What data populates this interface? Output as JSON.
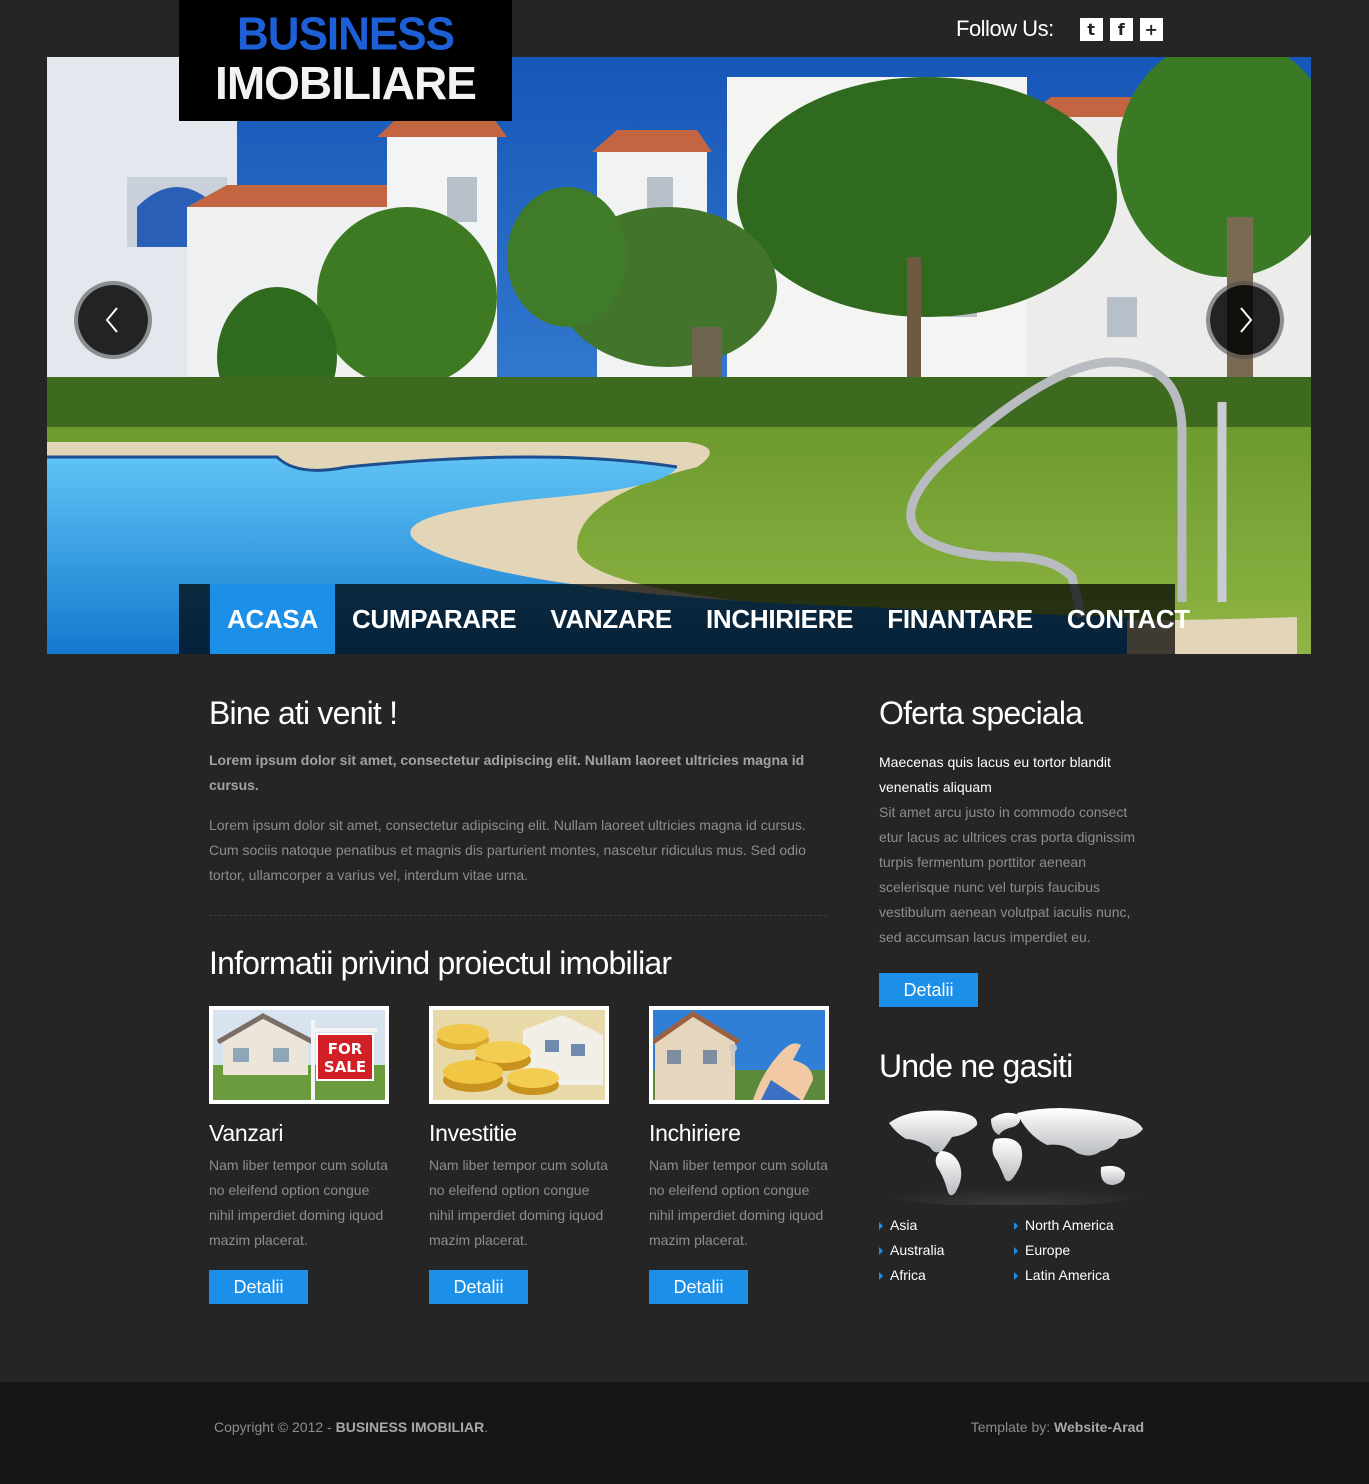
{
  "header": {
    "logo_line1": "BUSINESS",
    "logo_line2": "IMOBILIARE",
    "follow_label": "Follow Us:",
    "social": [
      "twitter-icon",
      "facebook-icon",
      "plus-icon"
    ],
    "twitter_glyph": "t",
    "facebook_glyph": "f",
    "plus_glyph": "+"
  },
  "slider": {
    "prev_icon": "chevron-left-icon",
    "next_icon": "chevron-right-icon"
  },
  "nav": {
    "items": [
      "ACASA",
      "CUMPARARE",
      "VANZARE",
      "INCHIRIERE",
      "FINANTARE",
      "CONTACT"
    ],
    "active": "ACASA"
  },
  "welcome": {
    "title": "Bine ati venit !",
    "lead": "Lorem ipsum dolor sit amet, consectetur adipiscing elit. Nullam laoreet ultricies magna id cursus.",
    "body": "Lorem ipsum dolor sit amet, consectetur adipiscing elit. Nullam laoreet ultricies magna id cursus. Cum sociis natoque penatibus et magnis dis parturient montes, nascetur ridiculus mus. Sed odio tortor, ullamcorper a varius vel, interdum vitae urna."
  },
  "info": {
    "title": "Informatii privind proiectul imobiliar",
    "cards": [
      {
        "title": "Vanzari",
        "text": "Nam liber tempor cum soluta no eleifend option congue nihil imperdiet doming iquod mazim placerat.",
        "button": "Detalii",
        "sign_line1": "FOR",
        "sign_line2": "SALE"
      },
      {
        "title": "Investitie",
        "text": "Nam liber tempor cum soluta no eleifend option congue nihil imperdiet doming iquod mazim placerat.",
        "button": "Detalii"
      },
      {
        "title": "Inchiriere",
        "text": "Nam liber tempor cum soluta no eleifend option congue nihil imperdiet doming iquod mazim placerat.",
        "button": "Detalii"
      }
    ]
  },
  "offer": {
    "title": "Oferta speciala",
    "highlight": "Maecenas quis lacus eu tortor blandit venenatis aliquam",
    "body": "Sit amet arcu justo in commodo consect etur lacus ac ultrices cras porta dignissim turpis fermentum porttitor aenean scelerisque nunc vel turpis faucibus vestibulum aenean volutpat iaculis nunc, sed accumsan lacus imperdiet eu.",
    "button": "Detalii"
  },
  "locations": {
    "title": "Unde ne gasiti",
    "regions": [
      "Asia",
      "North America",
      "Australia",
      "Europe",
      "Africa",
      "Latin America"
    ]
  },
  "footer": {
    "copyright_prefix": "Copyright © 2012 - ",
    "copyright_name": "BUSINESS IMOBILIAR",
    "copyright_suffix": ".",
    "template_prefix": "Template by: ",
    "template_name": "Website-Arad"
  },
  "colors": {
    "background": "#252525",
    "accent": "#1c8fe8",
    "footer": "#161616",
    "logo_blue": "#1c5fd6"
  }
}
